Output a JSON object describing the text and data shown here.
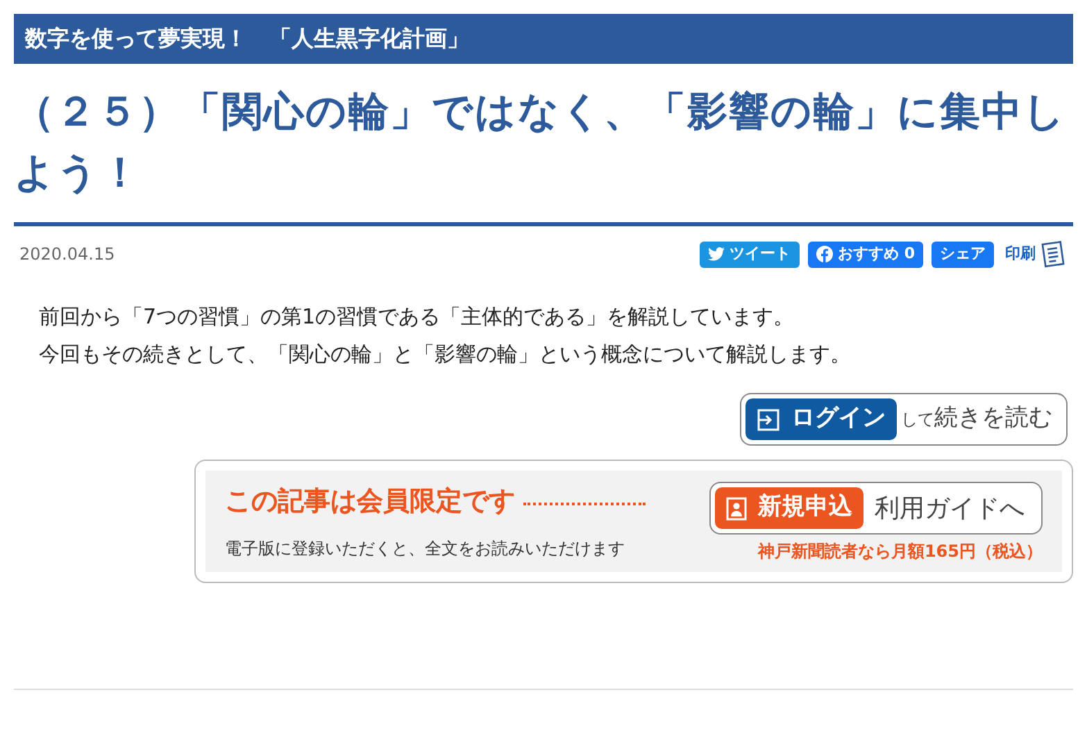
{
  "category_bar": {
    "title": "数字を使って夢実現！　「人生黒字化計画」"
  },
  "article": {
    "title": "（２５）「関心の輪」ではなく、「影響の輪」に集中しよう！",
    "date": "2020.04.15",
    "share_buttons": [
      {
        "kind": "tweet",
        "label": "ツイート"
      },
      {
        "kind": "facebook",
        "label": "おすすめ 0"
      },
      {
        "kind": "share",
        "label": "シェア"
      }
    ],
    "print_link": "印刷",
    "paragraphs": [
      "前回から「7つの習慣」の第1の習慣である「主体的である」を解説しています。",
      "今回もその続きとして、「関心の輪」と「影響の輪」という概念について解説します。"
    ]
  },
  "login_button": {
    "label": "ログイン",
    "suffix_small": "して",
    "suffix": "続きを読む"
  },
  "paywall": {
    "heading": "この記事は会員限定です",
    "note": "電子版に登録いただくと、全文をお読みいただけます",
    "signup_label": "新規申込",
    "guide_label": "利用ガイドへ",
    "price_note": "神戸新聞読者なら月額165円（税込）"
  }
}
